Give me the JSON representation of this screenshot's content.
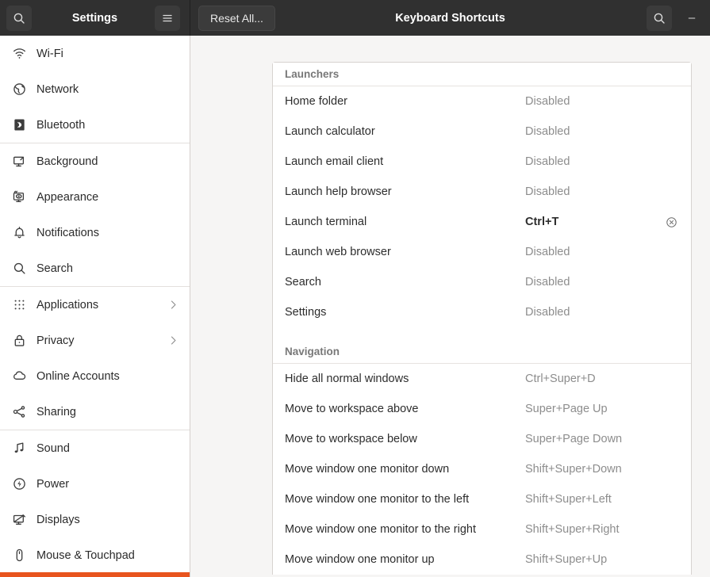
{
  "titlebar": {
    "search_icon": "search-icon",
    "sidebar_title": "Settings",
    "menu_icon": "hamburger-menu-icon",
    "reset_label": "Reset All...",
    "page_title": "Keyboard Shortcuts",
    "panel_search_icon": "search-icon",
    "minimize_label": "–"
  },
  "sidebar": {
    "groups": [
      {
        "items": [
          {
            "label": "Wi-Fi",
            "icon": "wifi-icon",
            "chevron": false
          },
          {
            "label": "Network",
            "icon": "network-globe-icon",
            "chevron": false
          },
          {
            "label": "Bluetooth",
            "icon": "bluetooth-icon",
            "chevron": false
          }
        ]
      },
      {
        "items": [
          {
            "label": "Background",
            "icon": "background-monitor-icon",
            "chevron": false
          },
          {
            "label": "Appearance",
            "icon": "appearance-icon",
            "chevron": false
          },
          {
            "label": "Notifications",
            "icon": "bell-icon",
            "chevron": false
          },
          {
            "label": "Search",
            "icon": "search-icon",
            "chevron": false
          }
        ]
      },
      {
        "items": [
          {
            "label": "Applications",
            "icon": "applications-grid-icon",
            "chevron": true
          },
          {
            "label": "Privacy",
            "icon": "lock-icon",
            "chevron": true
          },
          {
            "label": "Online Accounts",
            "icon": "cloud-icon",
            "chevron": false
          },
          {
            "label": "Sharing",
            "icon": "share-nodes-icon",
            "chevron": false
          }
        ]
      },
      {
        "items": [
          {
            "label": "Sound",
            "icon": "music-note-icon",
            "chevron": false
          },
          {
            "label": "Power",
            "icon": "power-icon",
            "chevron": false
          },
          {
            "label": "Displays",
            "icon": "displays-icon",
            "chevron": false
          },
          {
            "label": "Mouse & Touchpad",
            "icon": "mouse-icon",
            "chevron": false
          }
        ]
      }
    ],
    "accent_color": "#e8541e"
  },
  "shortcuts": {
    "sections": [
      {
        "title": "Launchers",
        "rows": [
          {
            "name": "Home folder",
            "accel": "Disabled",
            "is_set": false,
            "clearable": false
          },
          {
            "name": "Launch calculator",
            "accel": "Disabled",
            "is_set": false,
            "clearable": false
          },
          {
            "name": "Launch email client",
            "accel": "Disabled",
            "is_set": false,
            "clearable": false
          },
          {
            "name": "Launch help browser",
            "accel": "Disabled",
            "is_set": false,
            "clearable": false
          },
          {
            "name": "Launch terminal",
            "accel": "Ctrl+T",
            "is_set": true,
            "clearable": true
          },
          {
            "name": "Launch web browser",
            "accel": "Disabled",
            "is_set": false,
            "clearable": false
          },
          {
            "name": "Search",
            "accel": "Disabled",
            "is_set": false,
            "clearable": false
          },
          {
            "name": "Settings",
            "accel": "Disabled",
            "is_set": false,
            "clearable": false
          }
        ]
      },
      {
        "title": "Navigation",
        "rows": [
          {
            "name": "Hide all normal windows",
            "accel": "Ctrl+Super+D",
            "is_set": false,
            "clearable": false
          },
          {
            "name": "Move to workspace above",
            "accel": "Super+Page Up",
            "is_set": false,
            "clearable": false
          },
          {
            "name": "Move to workspace below",
            "accel": "Super+Page Down",
            "is_set": false,
            "clearable": false
          },
          {
            "name": "Move window one monitor down",
            "accel": "Shift+Super+Down",
            "is_set": false,
            "clearable": false
          },
          {
            "name": "Move window one monitor to the left",
            "accel": "Shift+Super+Left",
            "is_set": false,
            "clearable": false
          },
          {
            "name": "Move window one monitor to the right",
            "accel": "Shift+Super+Right",
            "is_set": false,
            "clearable": false
          },
          {
            "name": "Move window one monitor up",
            "accel": "Shift+Super+Up",
            "is_set": false,
            "clearable": false
          }
        ]
      }
    ],
    "clear_icon": "clear-circle-x-icon"
  }
}
